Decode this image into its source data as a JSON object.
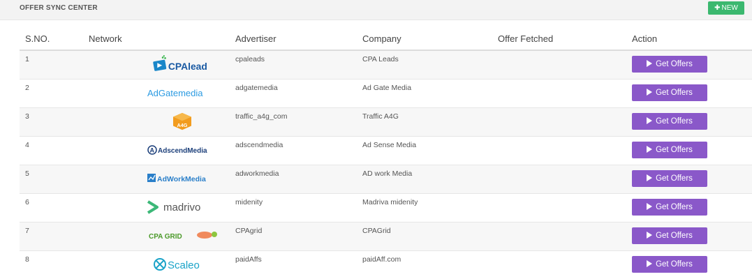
{
  "header": {
    "title": "OFFER SYNC CENTER",
    "new_label": "NEW"
  },
  "columns": [
    "S.NO.",
    "Network",
    "Advertiser",
    "Company",
    "Offer Fetched",
    "Action"
  ],
  "rows": [
    {
      "sno": "1",
      "network_logo": "cpalead-logo",
      "advertiser": "cpaleads",
      "company": "CPA Leads",
      "offer_fetched": "",
      "action": "Get Offers"
    },
    {
      "sno": "2",
      "network_logo": "adgatemedia-logo",
      "advertiser": "adgatemedia",
      "company": "Ad Gate Media",
      "offer_fetched": "",
      "action": "Get Offers"
    },
    {
      "sno": "3",
      "network_logo": "a4g-logo",
      "advertiser": "traffic_a4g_com",
      "company": "Traffic A4G",
      "offer_fetched": "",
      "action": "Get Offers"
    },
    {
      "sno": "4",
      "network_logo": "adscendmedia-logo",
      "advertiser": "adscendmedia",
      "company": "Ad Sense Media",
      "offer_fetched": "",
      "action": "Get Offers"
    },
    {
      "sno": "5",
      "network_logo": "adworkmedia-logo",
      "advertiser": "adworkmedia",
      "company": "AD work Media",
      "offer_fetched": "",
      "action": "Get Offers"
    },
    {
      "sno": "6",
      "network_logo": "madrivo-logo",
      "advertiser": "midenity",
      "company": "Madriva midenity",
      "offer_fetched": "",
      "action": "Get Offers"
    },
    {
      "sno": "7",
      "network_logo": "cpagrid-logo",
      "advertiser": "CPAgrid",
      "company": "CPAGrid",
      "offer_fetched": "",
      "action": "Get Offers"
    },
    {
      "sno": "8",
      "network_logo": "scaleo-logo",
      "advertiser": "paidAffs",
      "company": "paidAff.com",
      "offer_fetched": "",
      "action": "Get Offers"
    }
  ],
  "logo_text": {
    "cpalead": "CPAlead",
    "adgatemedia": "AdGatemedia",
    "a4g": "A4G",
    "adscendmedia": "AdscendMedia",
    "adworkmedia": "AdWorkMedia",
    "madrivo": "madrivo",
    "cpagrid": "CPA GRID",
    "scaleo": "Scaleo"
  },
  "colors": {
    "new_button": "#3bb86f",
    "get_offers_button": "#8a58c9"
  }
}
